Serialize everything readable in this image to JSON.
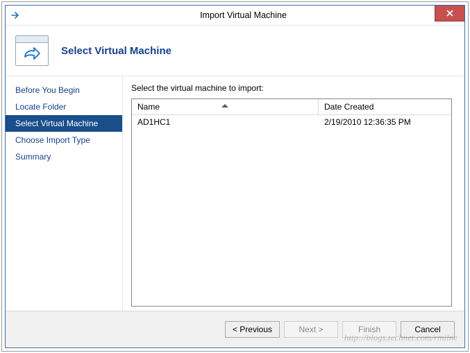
{
  "window": {
    "title": "Import Virtual Machine"
  },
  "header": {
    "page_title": "Select Virtual Machine"
  },
  "sidebar": {
    "items": [
      {
        "label": "Before You Begin",
        "selected": false
      },
      {
        "label": "Locate Folder",
        "selected": false
      },
      {
        "label": "Select Virtual Machine",
        "selected": true
      },
      {
        "label": "Choose Import Type",
        "selected": false
      },
      {
        "label": "Summary",
        "selected": false
      }
    ]
  },
  "main": {
    "instruction": "Select the virtual machine to import:",
    "columns": {
      "name": "Name",
      "date": "Date Created"
    },
    "rows": [
      {
        "name": "AD1HC1",
        "date": "2/19/2010 12:36:35 PM"
      }
    ]
  },
  "buttons": {
    "previous": "< Previous",
    "next": "Next >",
    "finish": "Finish",
    "cancel": "Cancel"
  },
  "watermark": "http://blogs.technet.com/rmilne"
}
